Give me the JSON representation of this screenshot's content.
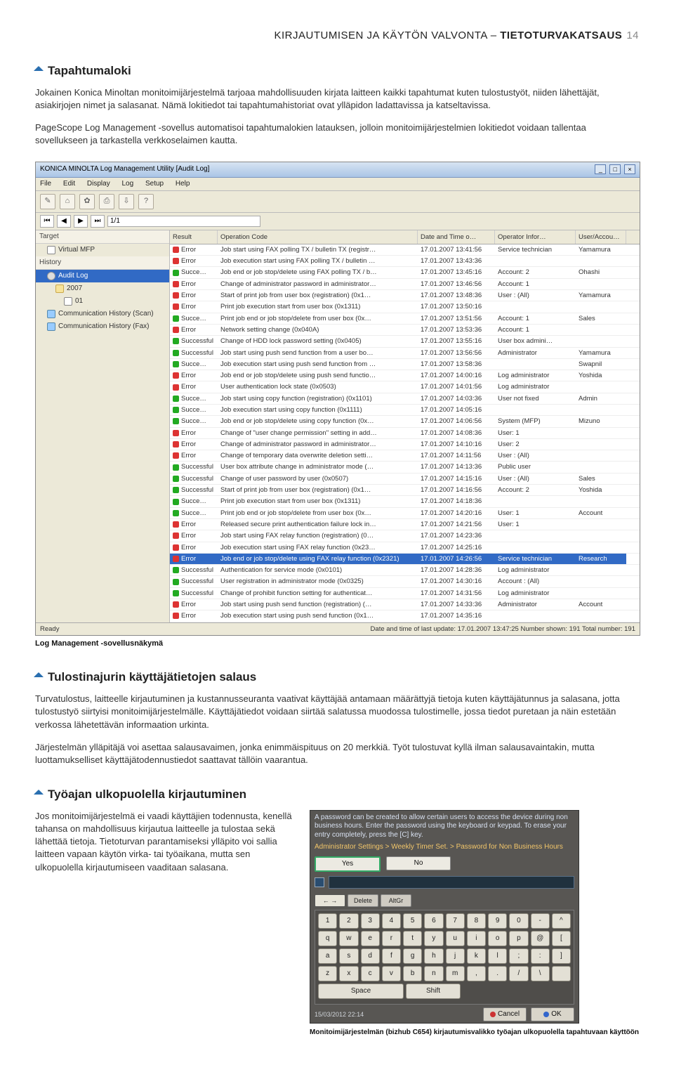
{
  "header": {
    "light": "KIRJAUTUMISEN JA KÄYTÖN VALVONTA – ",
    "bold": "TIETOTURVAKATSAUS",
    "page": "14"
  },
  "s1": {
    "title": "Tapahtumaloki",
    "p1": "Jokainen Konica Minoltan monitoimijärjestelmä tarjoaa mahdollisuuden kirjata laitteen kaikki tapahtumat kuten tulostustyöt, niiden lähettäjät, asiakirjojen nimet ja salasanat. Nämä lokitiedot tai tapahtumahistoriat ovat ylläpidon ladattavissa ja katseltavissa.",
    "p2": "PageScope Log Management -sovellus automatisoi tapahtumalokien latauksen, jolloin monitoimijärjestelmien lokitiedot voidaan tallentaa sovellukseen ja tarkastella verkkoselaimen kautta."
  },
  "app": {
    "title": "KONICA MINOLTA Log Management Utility [Audit Log]",
    "menu": [
      "File",
      "Edit",
      "Display",
      "Log",
      "Setup",
      "Help"
    ],
    "page_field": "1/1",
    "left": {
      "target_h": "Target",
      "target_item": "Virtual MFP",
      "history_h": "History",
      "items": [
        "Audit Log",
        "2007",
        "01",
        "Communication History (Scan)",
        "Communication History (Fax)"
      ]
    },
    "cols": [
      "Result",
      "Operation Code",
      "Date and Time o…",
      "Operator Infor…",
      "User/Accou…"
    ],
    "rows": [
      {
        "r": "Error",
        "op": "Job start using FAX polling TX / bulletin TX (registr…",
        "dt": "17.01.2007 13:41:56",
        "oi": "Service technician",
        "ua": "Yamamura"
      },
      {
        "r": "Error",
        "op": "Job execution start using FAX polling TX / bulletin …",
        "dt": "17.01.2007 13:43:36",
        "oi": "",
        "ua": ""
      },
      {
        "r": "Succe…",
        "op": "Job end or job stop/delete using FAX polling TX / b…",
        "dt": "17.01.2007 13:45:16",
        "oi": "Account: 2",
        "ua": "Ohashi"
      },
      {
        "r": "Error",
        "op": "Change of administrator password in administrator…",
        "dt": "17.01.2007 13:46:56",
        "oi": "Account: 1",
        "ua": ""
      },
      {
        "r": "Error",
        "op": "Start of print job from user box (registration) (0x1…",
        "dt": "17.01.2007 13:48:36",
        "oi": "User : (All)",
        "ua": "Yamamura"
      },
      {
        "r": "Error",
        "op": "Print job execution start from user box (0x1311)",
        "dt": "17.01.2007 13:50:16",
        "oi": "",
        "ua": ""
      },
      {
        "r": "Succe…",
        "op": "Print job end or job stop/delete from user box (0x…",
        "dt": "17.01.2007 13:51:56",
        "oi": "Account: 1",
        "ua": "Sales"
      },
      {
        "r": "Error",
        "op": "Network setting change (0x040A)",
        "dt": "17.01.2007 13:53:36",
        "oi": "Account: 1",
        "ua": ""
      },
      {
        "r": "Successful",
        "op": "Change of HDD lock password setting (0x0405)",
        "dt": "17.01.2007 13:55:16",
        "oi": "User box admini…",
        "ua": ""
      },
      {
        "r": "Successful",
        "op": "Job start using push send function from a user bo…",
        "dt": "17.01.2007 13:56:56",
        "oi": "Administrator",
        "ua": "Yamamura"
      },
      {
        "r": "Succe…",
        "op": "Job execution start using push send function from …",
        "dt": "17.01.2007 13:58:36",
        "oi": "",
        "ua": "Swapnil"
      },
      {
        "r": "Error",
        "op": "Job end or job stop/delete using push send functio…",
        "dt": "17.01.2007 14:00:16",
        "oi": "Log administrator",
        "ua": "Yoshida"
      },
      {
        "r": "Error",
        "op": "User authentication lock state (0x0503)",
        "dt": "17.01.2007 14:01:56",
        "oi": "Log administrator",
        "ua": ""
      },
      {
        "r": "Succe…",
        "op": "Job start using copy function (registration) (0x1101)",
        "dt": "17.01.2007 14:03:36",
        "oi": "User not fixed",
        "ua": "Admin"
      },
      {
        "r": "Succe…",
        "op": "Job execution start using copy function (0x1111)",
        "dt": "17.01.2007 14:05:16",
        "oi": "",
        "ua": ""
      },
      {
        "r": "Succe…",
        "op": "Job end or job stop/delete using copy function (0x…",
        "dt": "17.01.2007 14:06:56",
        "oi": "System (MFP)",
        "ua": "Mizuno"
      },
      {
        "r": "Error",
        "op": "Change of \"user change permission\" setting in add…",
        "dt": "17.01.2007 14:08:36",
        "oi": "User: 1",
        "ua": ""
      },
      {
        "r": "Error",
        "op": "Change of administrator password in administrator…",
        "dt": "17.01.2007 14:10:16",
        "oi": "User: 2",
        "ua": ""
      },
      {
        "r": "Error",
        "op": "Change of temporary data overwrite deletion setti…",
        "dt": "17.01.2007 14:11:56",
        "oi": "User : (All)",
        "ua": ""
      },
      {
        "r": "Successful",
        "op": "User box attribute change in administrator mode (…",
        "dt": "17.01.2007 14:13:36",
        "oi": "Public user",
        "ua": ""
      },
      {
        "r": "Successful",
        "op": "Change of user password by user (0x0507)",
        "dt": "17.01.2007 14:15:16",
        "oi": "User : (All)",
        "ua": "Sales"
      },
      {
        "r": "Successful",
        "op": "Start of print job from user box (registration) (0x1…",
        "dt": "17.01.2007 14:16:56",
        "oi": "Account: 2",
        "ua": "Yoshida"
      },
      {
        "r": "Succe…",
        "op": "Print job execution start from user box (0x1311)",
        "dt": "17.01.2007 14:18:36",
        "oi": "",
        "ua": ""
      },
      {
        "r": "Succe…",
        "op": "Print job end or job stop/delete from user box (0x…",
        "dt": "17.01.2007 14:20:16",
        "oi": "User: 1",
        "ua": "Account"
      },
      {
        "r": "Error",
        "op": "Released secure print authentication failure lock in…",
        "dt": "17.01.2007 14:21:56",
        "oi": "User: 1",
        "ua": ""
      },
      {
        "r": "Error",
        "op": "Job start using FAX relay function (registration) (0…",
        "dt": "17.01.2007 14:23:36",
        "oi": "",
        "ua": ""
      },
      {
        "r": "Error",
        "op": "Job execution start using FAX relay function (0x23…",
        "dt": "17.01.2007 14:25:16",
        "oi": "",
        "ua": ""
      },
      {
        "r": "Error",
        "op": "Job end or job stop/delete using FAX relay function (0x2321)",
        "dt": "17.01.2007 14:26:56",
        "oi": "Service technician",
        "ua": "Research",
        "sel": true
      },
      {
        "r": "Successful",
        "op": "Authentication for service mode (0x0101)",
        "dt": "17.01.2007 14:28:36",
        "oi": "Log administrator",
        "ua": ""
      },
      {
        "r": "Successful",
        "op": "User registration in administrator mode (0x0325)",
        "dt": "17.01.2007 14:30:16",
        "oi": "Account : (All)",
        "ua": ""
      },
      {
        "r": "Successful",
        "op": "Change of prohibit function setting for authenticat…",
        "dt": "17.01.2007 14:31:56",
        "oi": "Log administrator",
        "ua": ""
      },
      {
        "r": "Error",
        "op": "Job start using push send function (registration) (…",
        "dt": "17.01.2007 14:33:36",
        "oi": "Administrator",
        "ua": "Account"
      },
      {
        "r": "Error",
        "op": "Job execution start using push send function (0x1…",
        "dt": "17.01.2007 14:35:16",
        "oi": "",
        "ua": ""
      }
    ],
    "status_left": "Ready",
    "status_right": "Date and time of last update: 17.01.2007 13:47:25   Number shown: 191   Total number: 191"
  },
  "caption1": "Log Management -sovellusnäkymä",
  "s2": {
    "title": "Tulostinajurin käyttäjätietojen salaus",
    "p1": "Turvatulostus, laitteelle kirjautuminen ja kustannusseuranta vaativat käyttäjää antamaan määrättyjä tietoja kuten käyttäjätunnus ja salasana, jotta tulostustyö siirtyisi monitoimijärjestelmälle. Käyttäjätiedot voidaan siirtää salatussa muodossa tulostimelle, jossa tiedot puretaan ja näin estetään verkossa lähetettävän informaation urkinta.",
    "p2": "Järjestelmän ylläpitäjä voi asettaa salausavaimen, jonka enimmäispituus on 20 merkkiä. Työt tulostuvat kyllä ilman salausavaintakin, mutta luottamukselliset käyttäjätodennustiedot saattavat tällöin vaarantua."
  },
  "s3": {
    "title": "Työajan ulkopuolella kirjautuminen",
    "p1": "Jos monitoimijärjestelmä ei vaadi käyttäjien todennusta, kenellä tahansa on mahdollisuus kirjautua laitteelle ja tulostaa sekä lähettää tietoja. Tietoturvan parantamiseksi ylläpito voi sallia laitteen vapaan käytön virka- tai työaikana, mutta sen ulkopuolella kirjautumiseen vaaditaan salasana."
  },
  "ah": {
    "msg": "A password can be created to allow certain users to access the device during non business hours. Enter the password using the keyboard or keypad. To erase your entry completely, press the [C] key.",
    "breadcrumb": "Administrator Settings > Weekly Timer Set. > Password for Non Business Hours",
    "yes": "Yes",
    "no": "No",
    "tabs": [
      "← →",
      "Delete",
      "AltGr"
    ],
    "rows": [
      [
        "1",
        "2",
        "3",
        "4",
        "5",
        "6",
        "7",
        "8",
        "9",
        "0",
        "-",
        "^"
      ],
      [
        "q",
        "w",
        "e",
        "r",
        "t",
        "y",
        "u",
        "i",
        "o",
        "p",
        "@",
        "["
      ],
      [
        "a",
        "s",
        "d",
        "f",
        "g",
        "h",
        "j",
        "k",
        "l",
        ";",
        ":",
        "]"
      ],
      [
        "z",
        "x",
        "c",
        "v",
        "b",
        "n",
        "m",
        ",",
        ".",
        "/",
        "\\",
        " "
      ]
    ],
    "space": "Space",
    "shift": "Shift",
    "date": "15/03/2012   22:14",
    "cancel": "Cancel",
    "ok": "OK"
  },
  "caption2": "Monitoimijärjestelmän (bizhub C654) kirjautumisvalikko työajan ulkopuolella tapahtuvaan käyttöön"
}
